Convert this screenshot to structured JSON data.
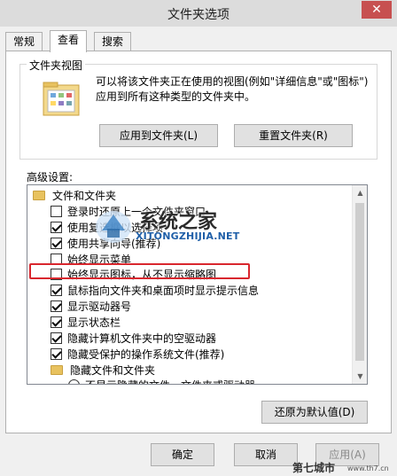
{
  "window": {
    "title": "文件夹选项",
    "close_label": "✕"
  },
  "tabs": [
    {
      "label": "常规",
      "active": false
    },
    {
      "label": "查看",
      "active": true
    },
    {
      "label": "搜索",
      "active": false
    }
  ],
  "folder_view": {
    "legend": "文件夹视图",
    "description": "可以将该文件夹正在使用的视图(例如\"详细信息\"或\"图标\")应用到所有这种类型的文件夹中。",
    "apply_button": "应用到文件夹(L)",
    "reset_button": "重置文件夹(R)"
  },
  "advanced": {
    "label": "高级设置:",
    "items": [
      {
        "type": "folder",
        "label": "文件和文件夹"
      },
      {
        "type": "checkbox",
        "checked": false,
        "label": "登录时还原上一个文件夹窗口"
      },
      {
        "type": "checkbox",
        "checked": true,
        "label": "使用复选框以选择项"
      },
      {
        "type": "checkbox",
        "checked": true,
        "label": "使用共享向导(推荐)"
      },
      {
        "type": "checkbox",
        "checked": false,
        "label": "始终显示菜单"
      },
      {
        "type": "checkbox",
        "checked": false,
        "label": "始终显示图标，从不显示缩略图"
      },
      {
        "type": "checkbox",
        "checked": true,
        "label": "鼠标指向文件夹和桌面项时显示提示信息"
      },
      {
        "type": "checkbox",
        "checked": true,
        "label": "显示驱动器号"
      },
      {
        "type": "checkbox",
        "checked": true,
        "label": "显示状态栏"
      },
      {
        "type": "checkbox",
        "checked": true,
        "label": "隐藏计算机文件夹中的空驱动器"
      },
      {
        "type": "checkbox",
        "checked": true,
        "label": "隐藏受保护的操作系统文件(推荐)"
      },
      {
        "type": "folder",
        "label": "隐藏文件和文件夹"
      },
      {
        "type": "radio",
        "label": "不显示隐藏的文件、文件夹或驱动器"
      }
    ],
    "restore_button": "还原为默认值(D)"
  },
  "footer": {
    "ok_button": "确定",
    "cancel_button": "取消",
    "apply_button": "应用(A)"
  },
  "watermarks": {
    "center_title": "系统之家",
    "center_url": "XITONGZHIJIA.NET",
    "corner_title": "第七城市",
    "corner_url": "www.th7.cn"
  },
  "colors": {
    "highlight": "#d9272e",
    "close_button": "#c75050",
    "folder": "#e8c25f"
  }
}
